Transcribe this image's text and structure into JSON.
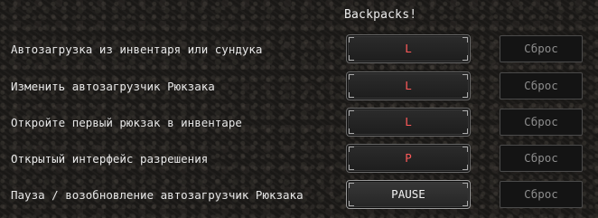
{
  "title": "Backpacks!",
  "reset_label": "Сброс",
  "bindings": [
    {
      "action": "Автозагрузка из инвентаря или сундука",
      "key": "L"
    },
    {
      "action": "Изменить автозагрузчик Рюкзака",
      "key": "L"
    },
    {
      "action": "Откройте первый рюкзак в инвентаре",
      "key": "L"
    },
    {
      "action": "Открытый интерфейс разрешения",
      "key": "P"
    },
    {
      "action": "Пауза / возобновление автозагрузчик Рюкзака",
      "key": "PAUSE"
    }
  ],
  "colors": {
    "conflict_key": "#ff5a5a",
    "active_key": "#f2f2f2",
    "reset_disabled": "#8c8c8c"
  }
}
